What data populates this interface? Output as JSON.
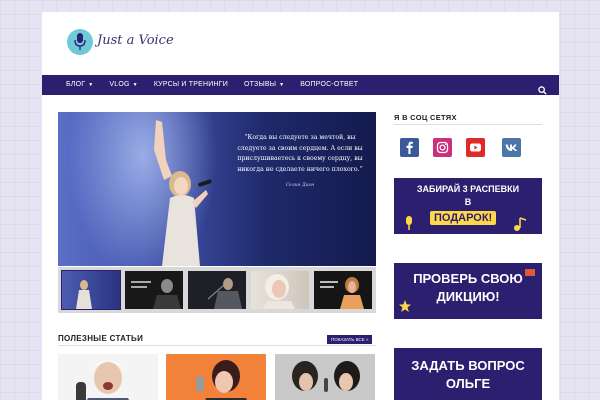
{
  "brand": {
    "name": "Just a Voice",
    "logo_color": "#6fc9d6",
    "logo_icon": "microphone-icon"
  },
  "nav": {
    "items": [
      {
        "label": "БЛОГ",
        "dropdown": true
      },
      {
        "label": "VLOG",
        "dropdown": true
      },
      {
        "label": "КУРСЫ И ТРЕНИНГИ",
        "dropdown": false
      },
      {
        "label": "ОТЗЫВЫ",
        "dropdown": true
      },
      {
        "label": "ВОПРОС-ОТВЕТ",
        "dropdown": false
      }
    ],
    "search_icon": "search-icon",
    "background": "#2c1f70"
  },
  "hero": {
    "quote": "“Когда вы следуете за мечтой, вы следуете за своим сердцем. А если вы прислушиваетесь к своему сердцу, вы никогда не сделаете ничего плохого.”",
    "author": "Селин Дион"
  },
  "thumbnails_count": 5,
  "articles": {
    "title": "ПОЛЕЗНЫЕ СТАТЬИ",
    "show_all": "ПОКАЗАТЬ ВСЕ »"
  },
  "sidebar": {
    "social_title": "Я В СОЦ СЕТЯХ",
    "social": [
      {
        "name": "facebook-icon",
        "color": "#3b5998"
      },
      {
        "name": "instagram-icon",
        "color": "#c9307e"
      },
      {
        "name": "youtube-icon",
        "color": "#e02a26"
      },
      {
        "name": "vk-icon",
        "color": "#4a76a8"
      }
    ],
    "banners": [
      {
        "line1": "ЗАБИРАЙ 3 РАСПЕВКИ",
        "line2": "В",
        "line3": "ПОДАРОК!"
      },
      {
        "line1": "ПРОВЕРЬ СВОЮ",
        "line2": "ДИКЦИЮ!"
      },
      {
        "line1": "ЗАДАТЬ ВОПРОС",
        "line2": "ОЛЬГЕ"
      }
    ],
    "banner_color": "#2c1f70",
    "accent_color": "#ffd84a"
  }
}
